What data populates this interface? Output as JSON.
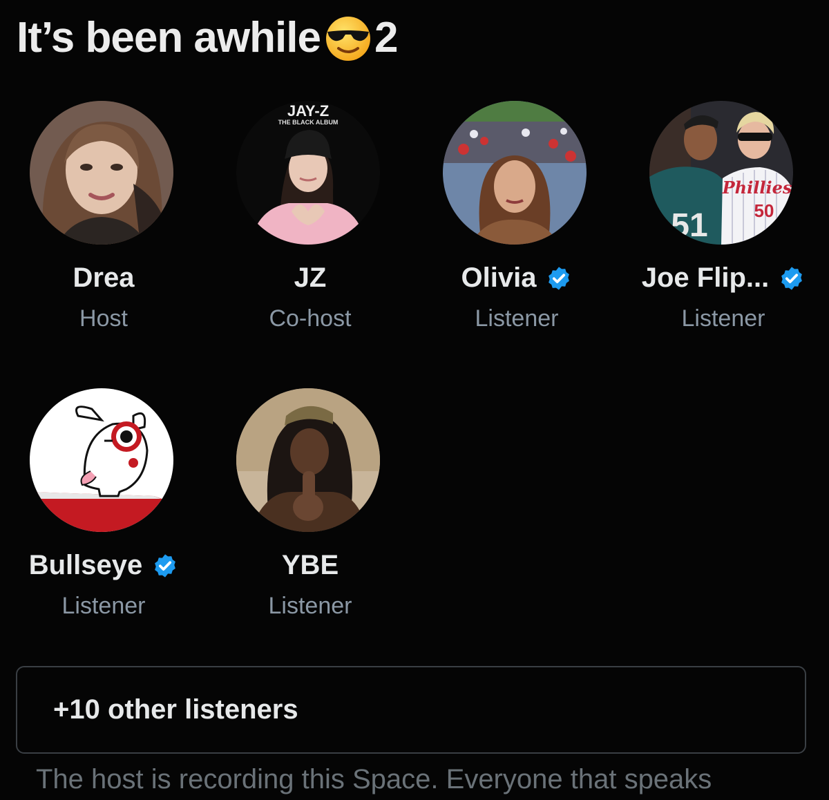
{
  "space": {
    "title_text": "It’s been awhile",
    "title_emoji": "smiling-face-with-sunglasses-emoji",
    "title_suffix": "2"
  },
  "participants": [
    {
      "name": "Drea",
      "role": "Host",
      "verified": false,
      "avatar": "woman-portrait-avatar"
    },
    {
      "name": "JZ",
      "role": "Co-host",
      "verified": false,
      "avatar": "black-album-woman-avatar",
      "avatar_text_1": "JAY-Z",
      "avatar_text_2": "THE BLACK ALBUM"
    },
    {
      "name": "Olivia",
      "role": "Listener",
      "verified": true,
      "avatar": "stadium-selfie-avatar"
    },
    {
      "name": "Joe Flip...",
      "role": "Listener",
      "verified": true,
      "avatar": "eagles-phillies-fans-avatar",
      "avatar_text_1": "Phillies",
      "avatar_text_2": "50",
      "avatar_text_3": "51"
    },
    {
      "name": "Bullseye",
      "role": "Listener",
      "verified": true,
      "avatar": "bullseye-dog-avatar"
    },
    {
      "name": "YBE",
      "role": "Listener",
      "verified": false,
      "avatar": "woman-braids-avatar"
    }
  ],
  "others": {
    "label": "+10 other listeners"
  },
  "notice": {
    "text": "The host is recording this Space. Everyone that speaks"
  },
  "colors": {
    "background": "#050505",
    "name": "#e7e9ea",
    "role": "#8b98a5",
    "verified": "#1d9bf0",
    "border": "#3a3f44"
  }
}
